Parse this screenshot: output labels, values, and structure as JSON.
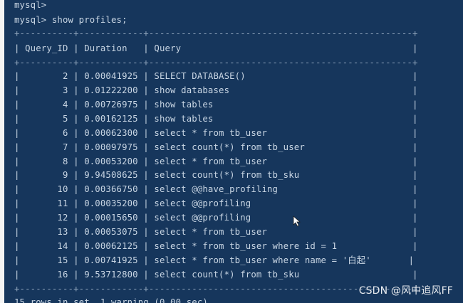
{
  "terminal": {
    "prompt_lines": [
      "mysql>",
      "mysql> show profiles;"
    ],
    "table": {
      "border": "+----------+------------+-------------------------------------------------+",
      "header": "| Query_ID | Duration   | Query                                           |",
      "rows": [
        "|        2 | 0.00041925 | SELECT DATABASE()                               |",
        "|        3 | 0.01222200 | show databases                                  |",
        "|        4 | 0.00726975 | show tables                                     |",
        "|        5 | 0.00162125 | show tables                                     |",
        "|        6 | 0.00062300 | select * from tb_user                           |",
        "|        7 | 0.00097975 | select count(*) from tb_user                    |",
        "|        8 | 0.00053200 | select * from tb_user                           |",
        "|        9 | 9.94508625 | select count(*) from tb_sku                     |",
        "|       10 | 0.00366750 | select @@have_profiling                         |",
        "|       11 | 0.00035200 | select @@profiling                              |",
        "|       12 | 0.00015650 | select @@profiling                              |",
        "|       13 | 0.00053075 | select * from tb_user                           |",
        "|       14 | 0.00062125 | select * from tb_user where id = 1              |",
        "|       15 | 0.00741925 | select * from tb_user where name = '白起'       |",
        "|       16 | 9.53712800 | select count(*) from tb_sku                     |"
      ],
      "footer_border": "+----------+------------+-------------------------------------------------+"
    },
    "summary": "15 rows in set, 1 warning (0.00 sec)"
  },
  "watermark": "CSDN @风中追风FF",
  "colors": {
    "background": "#16365c",
    "text": "#c9d6e4",
    "border": "#8fa4bb"
  },
  "icons": [
    "mouse-pointer-icon"
  ]
}
